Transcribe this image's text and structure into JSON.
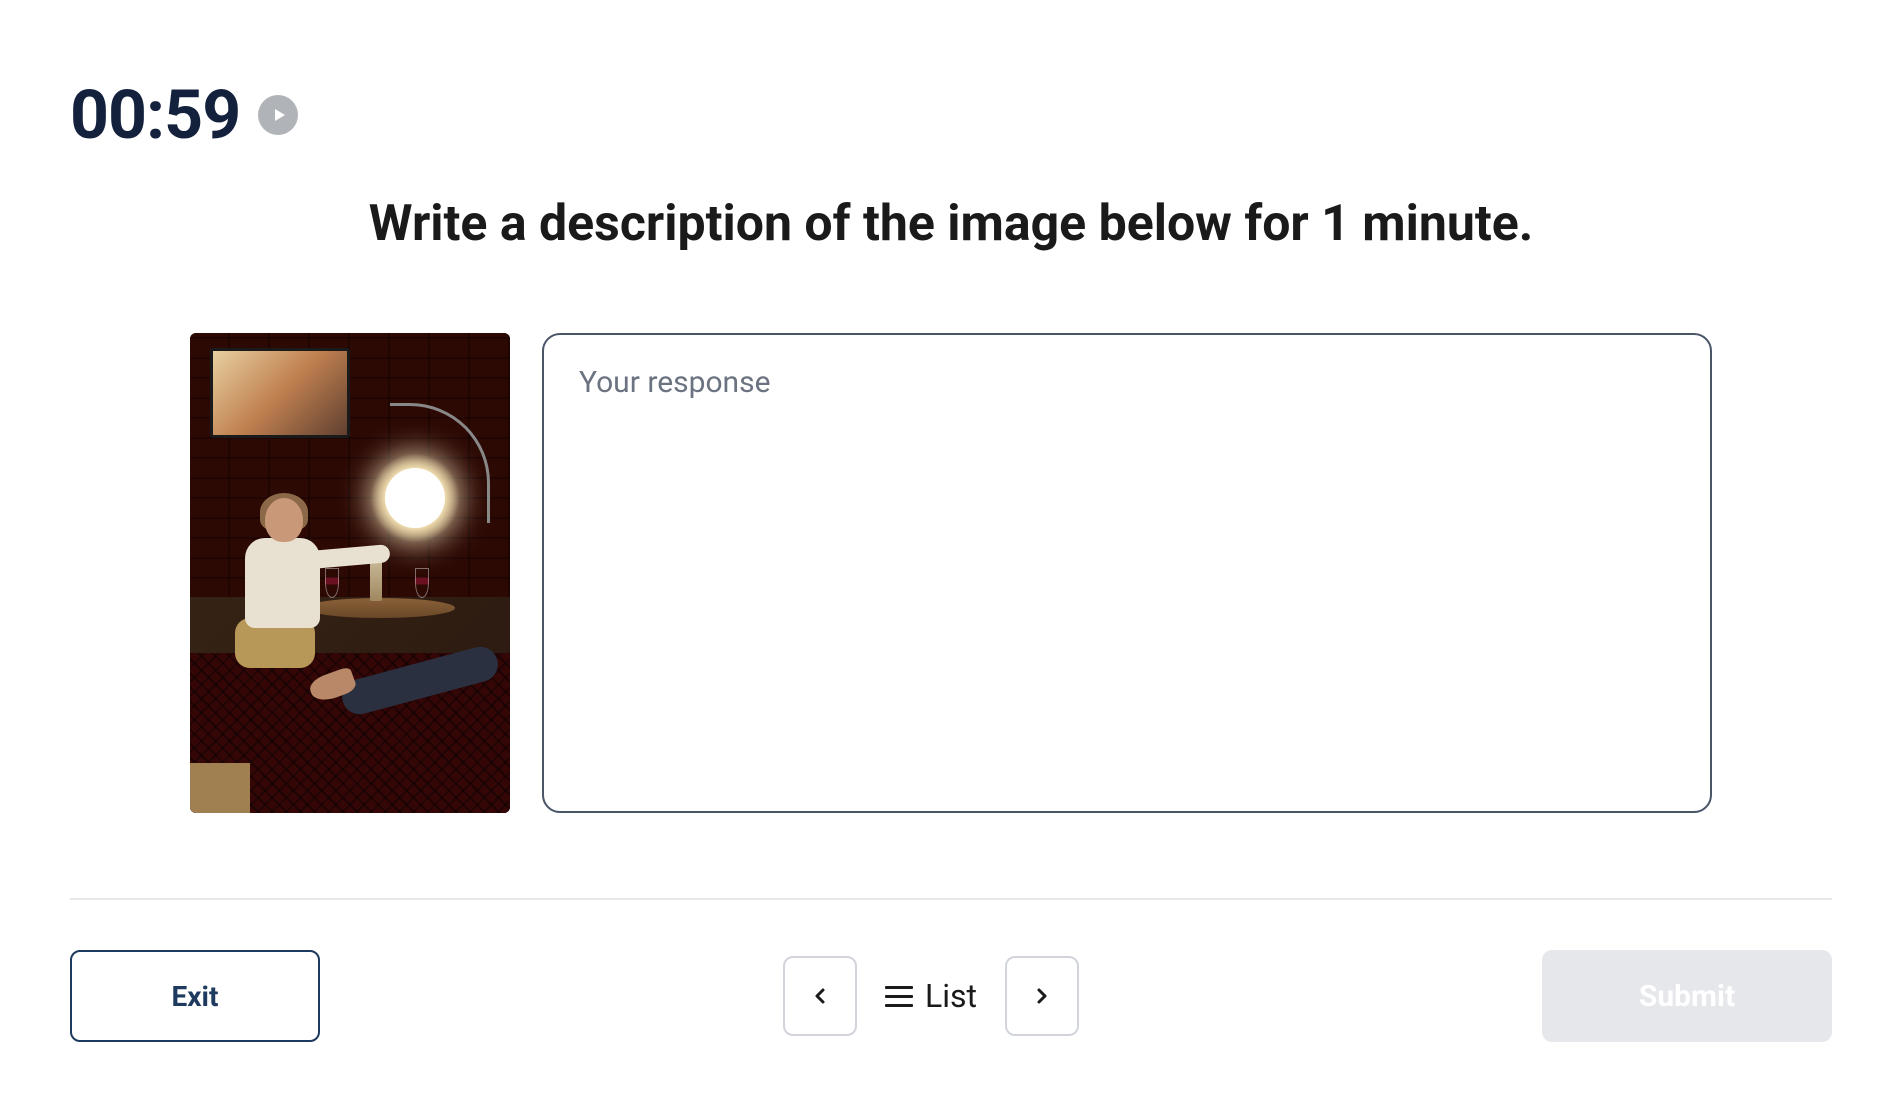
{
  "timer": {
    "display": "00:59"
  },
  "prompt": {
    "title": "Write a description of the image below for 1 minute."
  },
  "response": {
    "placeholder": "Your response",
    "value": ""
  },
  "footer": {
    "exit_label": "Exit",
    "list_label": "List",
    "submit_label": "Submit"
  },
  "icons": {
    "play": "play-icon",
    "prev": "chevron-left-icon",
    "next": "chevron-right-icon",
    "list": "hamburger-icon"
  }
}
